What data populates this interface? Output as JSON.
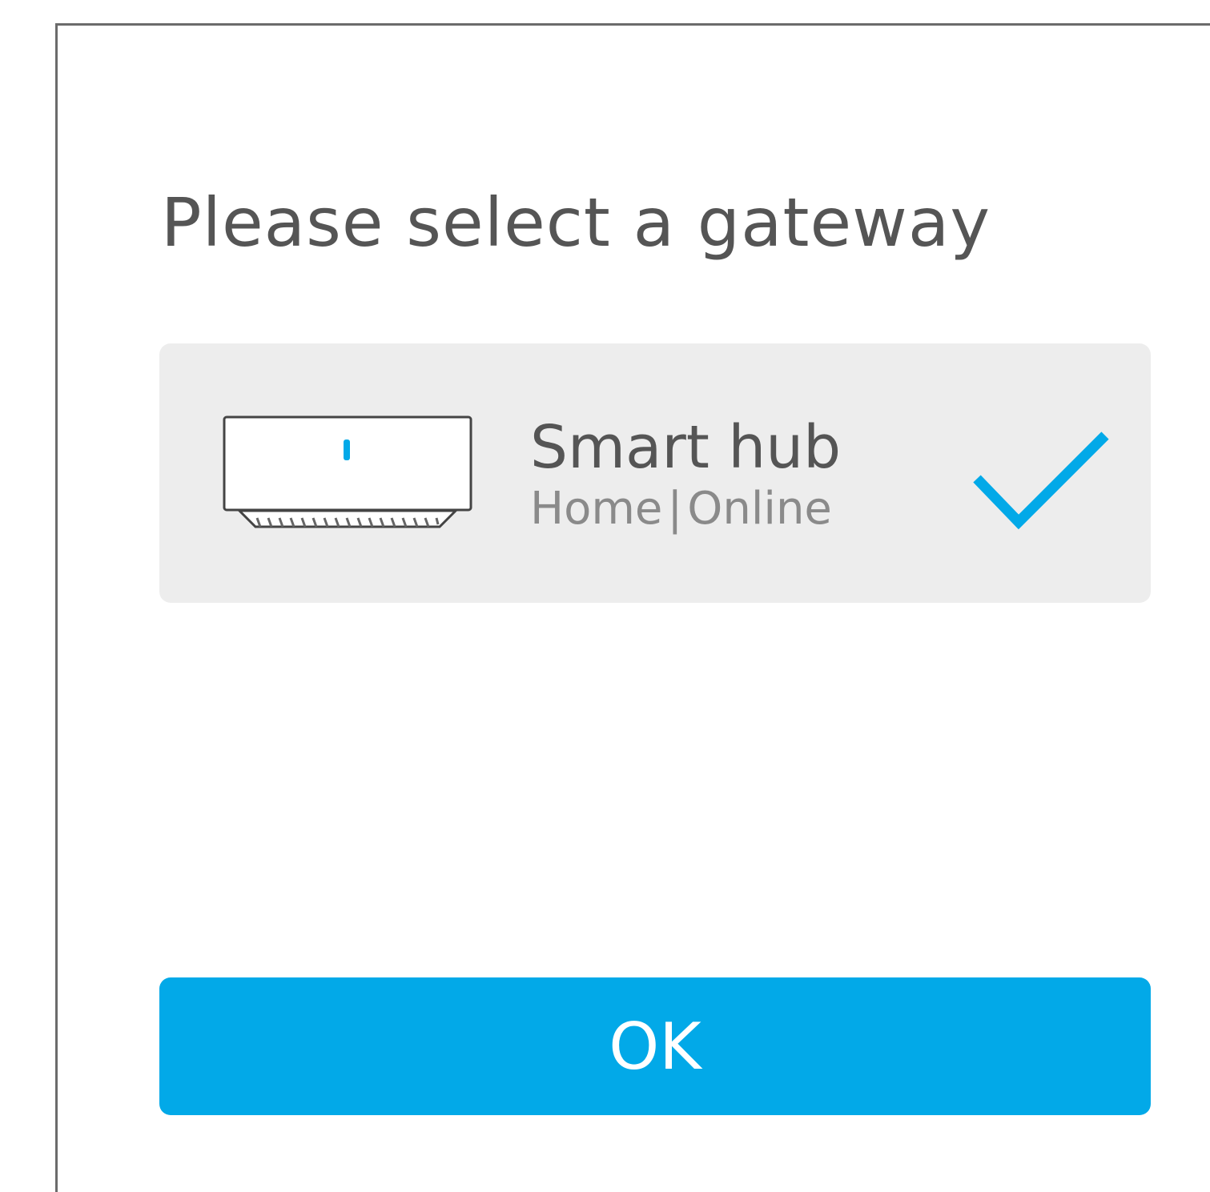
{
  "dialog": {
    "title": "Please select a gateway",
    "ok_label": "OK"
  },
  "gateway": {
    "name": "Smart hub",
    "room": "Home",
    "separator": "|",
    "status": "Online",
    "selected": true,
    "icon": "smart-hub-device",
    "check_icon": "checkmark-icon"
  },
  "colors": {
    "accent": "#02a9e8",
    "card_bg": "#ededed",
    "title_text": "#555555",
    "secondary_text": "#8a8a8a"
  }
}
